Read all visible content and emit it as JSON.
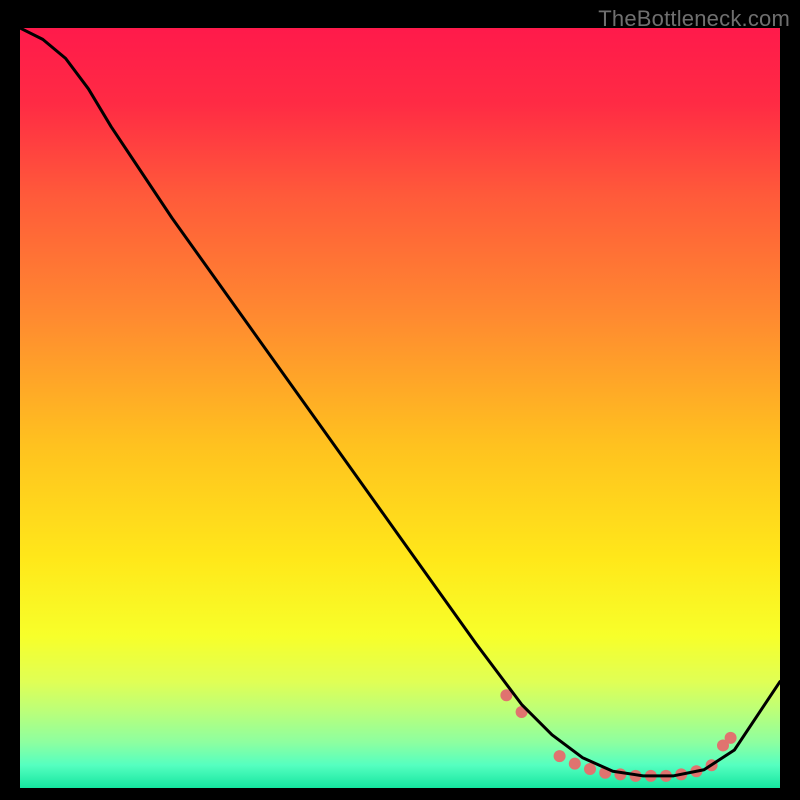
{
  "watermark": "TheBottleneck.com",
  "chart_data": {
    "type": "line",
    "title": "",
    "xlabel": "",
    "ylabel": "",
    "xlim": [
      0,
      100
    ],
    "ylim": [
      0,
      100
    ],
    "grid": false,
    "legend": false,
    "gradient_stops": [
      {
        "offset": 0.0,
        "color": "#ff1a4b"
      },
      {
        "offset": 0.1,
        "color": "#ff2b44"
      },
      {
        "offset": 0.22,
        "color": "#ff5a3a"
      },
      {
        "offset": 0.38,
        "color": "#ff8a30"
      },
      {
        "offset": 0.55,
        "color": "#ffc21f"
      },
      {
        "offset": 0.7,
        "color": "#ffe81a"
      },
      {
        "offset": 0.8,
        "color": "#f7ff2a"
      },
      {
        "offset": 0.86,
        "color": "#e0ff55"
      },
      {
        "offset": 0.9,
        "color": "#baff7a"
      },
      {
        "offset": 0.94,
        "color": "#8dffa0"
      },
      {
        "offset": 0.97,
        "color": "#55ffc0"
      },
      {
        "offset": 1.0,
        "color": "#15e6a0"
      }
    ],
    "series": [
      {
        "name": "curve",
        "stroke": "#000000",
        "stroke_width": 3,
        "x": [
          0,
          3,
          6,
          9,
          12,
          20,
          30,
          40,
          50,
          60,
          66,
          70,
          74,
          78,
          82,
          86,
          90,
          94,
          100
        ],
        "y": [
          100,
          98.5,
          96,
          92,
          87,
          75,
          61,
          47,
          33,
          19,
          11,
          7,
          4,
          2.2,
          1.6,
          1.6,
          2.4,
          5,
          14
        ]
      }
    ],
    "markers": {
      "name": "dots",
      "color": "#e0736f",
      "radius": 6,
      "x": [
        64,
        66,
        71,
        73,
        75,
        77,
        79,
        81,
        83,
        85,
        87,
        89,
        91,
        92.5,
        93.5
      ],
      "y": [
        12.2,
        10.0,
        4.2,
        3.2,
        2.5,
        2.0,
        1.8,
        1.6,
        1.6,
        1.6,
        1.8,
        2.2,
        3.0,
        5.6,
        6.6
      ]
    }
  }
}
